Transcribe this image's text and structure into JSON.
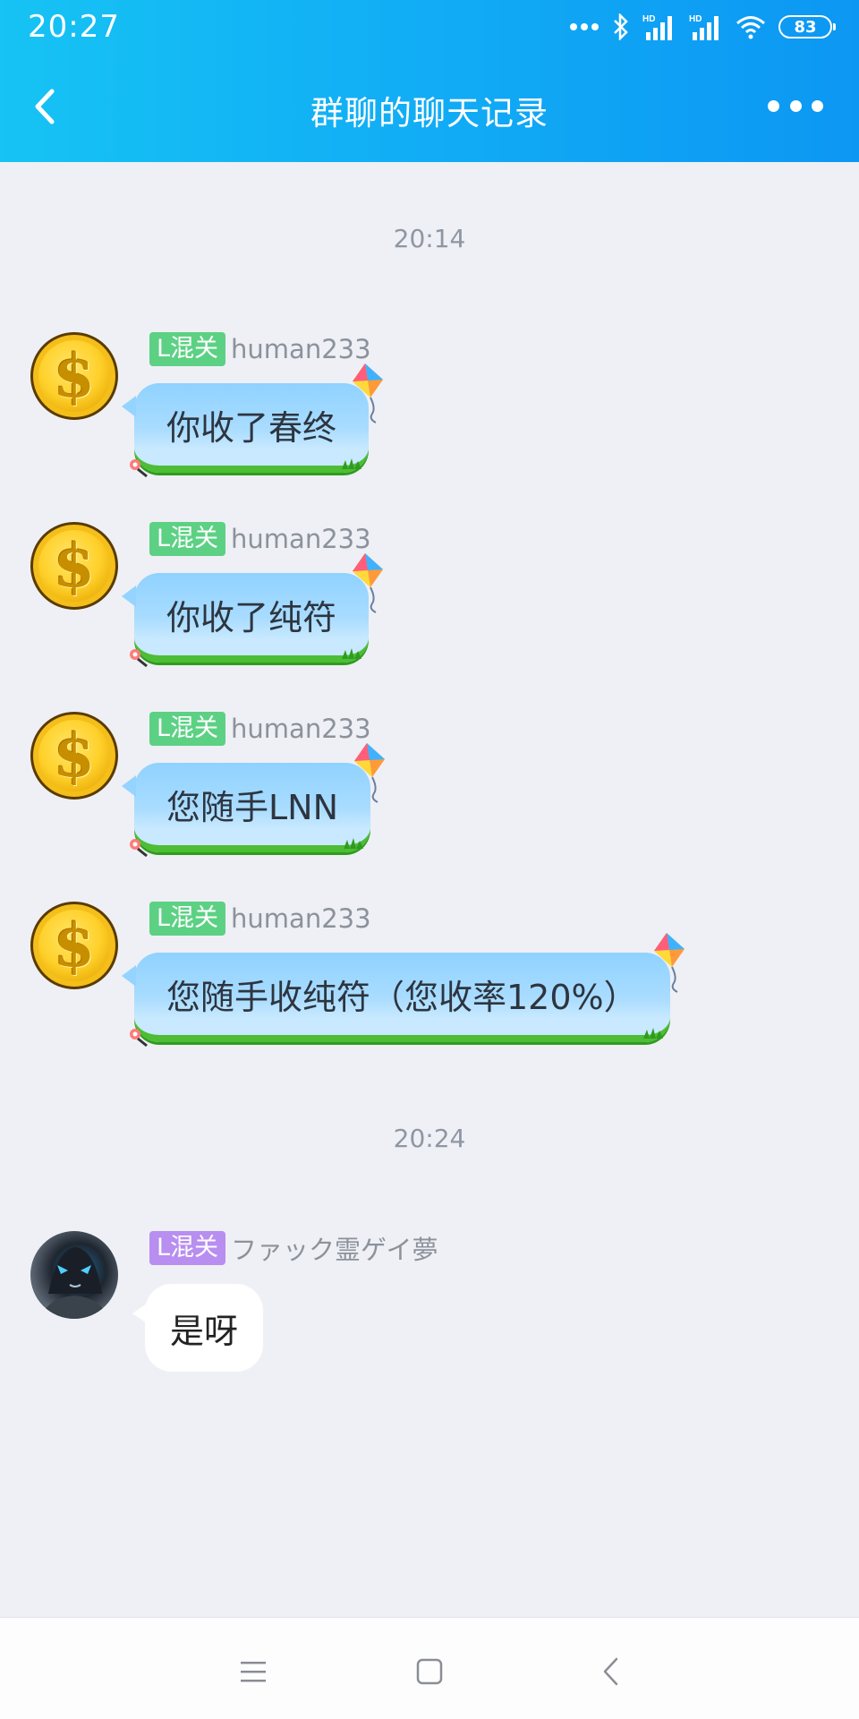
{
  "status_bar": {
    "time": "20:27",
    "battery": "83",
    "icons": [
      "more-dots-icon",
      "bluetooth-icon",
      "hd-signal-icon",
      "hd-signal-icon",
      "wifi-icon",
      "battery-icon"
    ]
  },
  "header": {
    "title": "群聊的聊天记录",
    "back_icon": "back-chevron-icon",
    "more_icon": "more-dots-icon",
    "background": "#11acf5"
  },
  "timestamps": [
    "20:14",
    "20:24"
  ],
  "messages": [
    {
      "tag": "L混关",
      "tag_color": "#5cd184",
      "sender": "human233",
      "avatar": "gold-coin-dollar",
      "text": "你收了春终"
    },
    {
      "tag": "L混关",
      "tag_color": "#5cd184",
      "sender": "human233",
      "avatar": "gold-coin-dollar",
      "text": "你收了纯符"
    },
    {
      "tag": "L混关",
      "tag_color": "#5cd184",
      "sender": "human233",
      "avatar": "gold-coin-dollar",
      "text": "您随手LNN"
    },
    {
      "tag": "L混关",
      "tag_color": "#5cd184",
      "sender": "human233",
      "avatar": "gold-coin-dollar",
      "text": "您随手收纯符（您收率120%）"
    },
    {
      "tag": "L混关",
      "tag_color": "#b88ef0",
      "sender": "ファック霊ゲイ夢",
      "avatar": "anime-character-photo",
      "text": "是呀"
    }
  ],
  "nav_bar": {
    "buttons": [
      "menu-icon",
      "home-square-icon",
      "back-triangle-icon"
    ]
  }
}
